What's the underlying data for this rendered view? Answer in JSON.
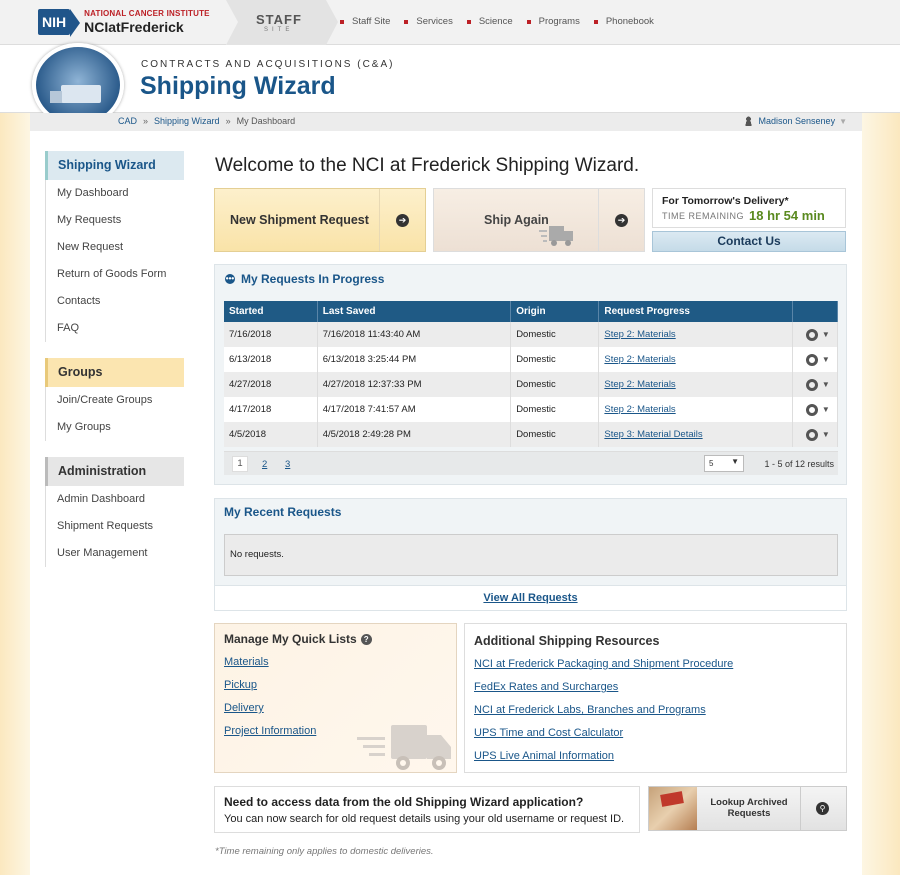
{
  "header": {
    "nih": "NIH",
    "nci_line1": "NATIONAL CANCER INSTITUTE",
    "nci_line2": "NCIatFrederick",
    "staff": "STAFF",
    "site": "SITE",
    "nav": [
      "Staff Site",
      "Services",
      "Science",
      "Programs",
      "Phonebook"
    ]
  },
  "hero": {
    "dept": "CONTRACTS AND ACQUISITIONS (C&A)",
    "title": "Shipping Wizard"
  },
  "breadcrumb": {
    "items": [
      "CAD",
      "Shipping Wizard",
      "My Dashboard"
    ],
    "sep": "»"
  },
  "user": {
    "name": "Madison Senseney"
  },
  "sidebar": {
    "sections": [
      {
        "title": "Shipping Wizard",
        "items": [
          "My Dashboard",
          "My Requests",
          "New Request",
          "Return of Goods Form",
          "Contacts",
          "FAQ"
        ]
      },
      {
        "title": "Groups",
        "items": [
          "Join/Create Groups",
          "My Groups"
        ]
      },
      {
        "title": "Administration",
        "items": [
          "Admin Dashboard",
          "Shipment Requests",
          "User Management"
        ]
      }
    ]
  },
  "main": {
    "welcome": "Welcome to the NCI at Frederick Shipping Wizard.",
    "new_shipment": "New Shipment Request",
    "ship_again": "Ship Again",
    "delivery_title": "For Tomorrow's Delivery*",
    "time_label": "TIME REMAINING",
    "time_value": "18 hr 54 min",
    "contact_us": "Contact Us"
  },
  "in_progress": {
    "title": "My Requests In Progress",
    "columns": [
      "Started",
      "Last Saved",
      "Origin",
      "Request Progress"
    ],
    "rows": [
      [
        "7/16/2018",
        "7/16/2018 11:43:40 AM",
        "Domestic",
        "Step 2: Materials"
      ],
      [
        "6/13/2018",
        "6/13/2018 3:25:44 PM",
        "Domestic",
        "Step 2: Materials"
      ],
      [
        "4/27/2018",
        "4/27/2018 12:37:33 PM",
        "Domestic",
        "Step 2: Materials"
      ],
      [
        "4/17/2018",
        "4/17/2018 7:41:57 AM",
        "Domestic",
        "Step 2: Materials"
      ],
      [
        "4/5/2018",
        "4/5/2018 2:49:28 PM",
        "Domestic",
        "Step 3: Material Details"
      ]
    ],
    "pages": [
      "1",
      "2",
      "3"
    ],
    "page_size": "5",
    "results": "1 - 5 of 12 results"
  },
  "recent": {
    "title": "My Recent Requests",
    "empty": "No requests.",
    "view_all": "View All Requests"
  },
  "quick_lists": {
    "title": "Manage My Quick Lists",
    "help": "?",
    "items": [
      "Materials",
      "Pickup",
      "Delivery",
      "Project Information"
    ]
  },
  "resources": {
    "title": "Additional Shipping Resources",
    "links": [
      "NCI at Frederick Packaging and Shipment Procedure",
      "FedEx Rates and Surcharges",
      "NCI at Frederick Labs, Branches and Programs",
      "UPS Time and Cost Calculator",
      "UPS Live Animal Information"
    ]
  },
  "old_app": {
    "title": "Need to access data from the old Shipping Wizard application?",
    "text": "You can now search for old request details using your old username or request ID.",
    "lookup": "Lookup Archived Requests"
  },
  "footnote": "*Time remaining only applies to domestic deliveries.",
  "colors": {
    "brand_blue": "#1a5689",
    "nci_red": "#bc2026",
    "table_header": "#1f5a85",
    "time_green": "#5a8a1f"
  },
  "icons": [
    "arrow-right-icon",
    "truck-icon",
    "gear-icon",
    "chevron-down-icon",
    "collapse-icon",
    "help-icon",
    "search-icon",
    "user-icon"
  ]
}
